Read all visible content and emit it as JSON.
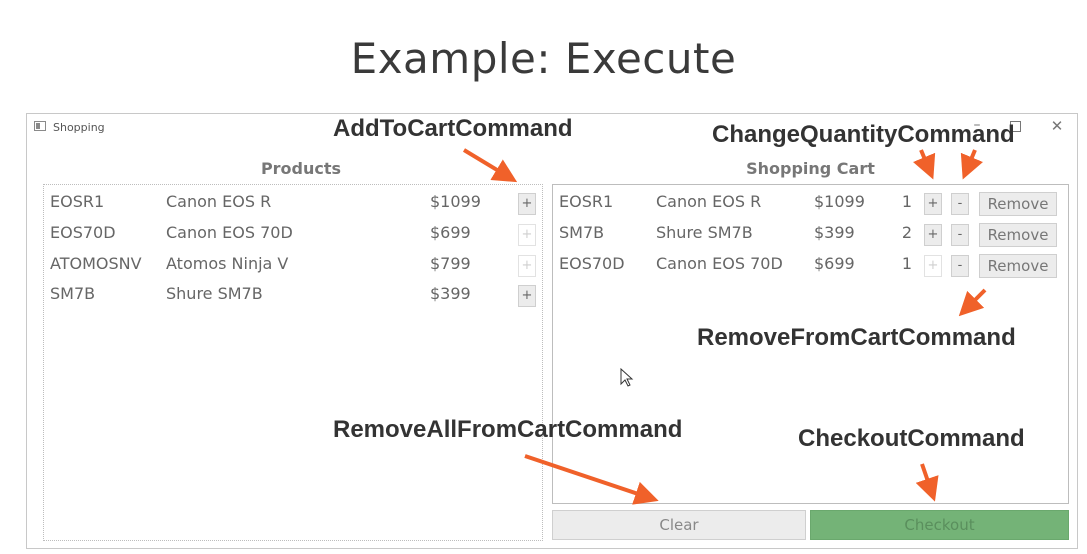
{
  "slide": {
    "title": "Example: Execute"
  },
  "window": {
    "title": "Shopping",
    "minimize_glyph": "–",
    "close_glyph": "✕"
  },
  "products": {
    "header": "Products",
    "items": [
      {
        "code": "EOSR1",
        "name": "Canon EOS R",
        "price": "$1099",
        "add_label": "+",
        "add_enabled": true
      },
      {
        "code": "EOS70D",
        "name": "Canon EOS 70D",
        "price": "$699",
        "add_label": "+",
        "add_enabled": false
      },
      {
        "code": "ATOMOSNV",
        "name": "Atomos Ninja V",
        "price": "$799",
        "add_label": "+",
        "add_enabled": false
      },
      {
        "code": "SM7B",
        "name": "Shure SM7B",
        "price": "$399",
        "add_label": "+",
        "add_enabled": true
      }
    ]
  },
  "cart": {
    "header": "Shopping Cart",
    "items": [
      {
        "code": "EOSR1",
        "name": "Canon EOS R",
        "price": "$1099",
        "qty": "1",
        "plus_label": "+",
        "plus_enabled": true,
        "minus_label": "-",
        "remove_label": "Remove"
      },
      {
        "code": "SM7B",
        "name": "Shure SM7B",
        "price": "$399",
        "qty": "2",
        "plus_label": "+",
        "plus_enabled": true,
        "minus_label": "-",
        "remove_label": "Remove"
      },
      {
        "code": "EOS70D",
        "name": "Canon EOS 70D",
        "price": "$699",
        "qty": "1",
        "plus_label": "+",
        "plus_enabled": false,
        "minus_label": "-",
        "remove_label": "Remove"
      }
    ]
  },
  "actions": {
    "clear_label": "Clear",
    "checkout_label": "Checkout"
  },
  "annotations": {
    "add_to_cart": "AddToCartCommand",
    "change_quantity": "ChangeQuantityCommand",
    "remove_from_cart": "RemoveFromCartCommand",
    "remove_all": "RemoveAllFromCartCommand",
    "checkout": "CheckoutCommand"
  },
  "colors": {
    "arrow": "#f0612a",
    "checkout": "#74b377",
    "annotation_text": "#333333"
  }
}
